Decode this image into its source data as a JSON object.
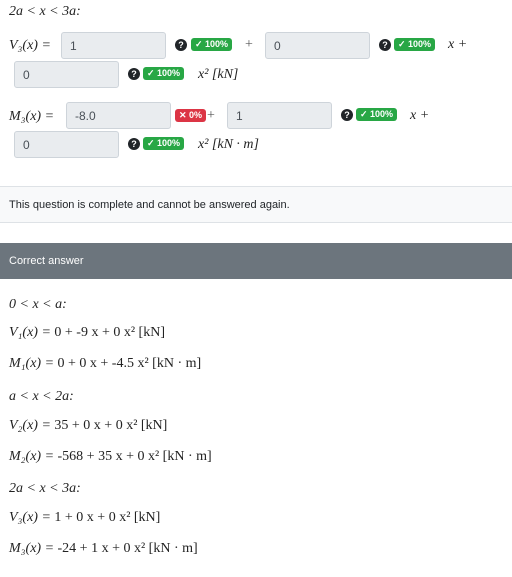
{
  "question": {
    "range_label": "2a < x < 3a:",
    "v3": {
      "label": "V₃(x) =",
      "field1": "1",
      "field2": "0",
      "field3": "0",
      "badge1": "✓ 100%",
      "badge2": "✓ 100%",
      "badge3": "✓ 100%",
      "x_plus": "x +",
      "unit": "x² [kN]"
    },
    "m3": {
      "label": "M₃(x) =",
      "field1": "-8.0",
      "field2": "1",
      "field3": "0",
      "badge1": "✕ 0%",
      "badge2": "✓ 100%",
      "badge3": "✓ 100%",
      "x_plus": "x +",
      "unit": "x² [kN · m]"
    },
    "plus": "+",
    "help_icon": "?"
  },
  "status": {
    "complete_message": "This question is complete and cannot be answered again."
  },
  "correct_answer": {
    "heading": "Correct answer",
    "sections": [
      {
        "range": "0 < x < a:",
        "v_label": "V₁(x) = ",
        "v_value": "0 + -9 x + 0 x² [kN]",
        "m_label": "M₁(x) = ",
        "m_value": "0 + 0 x + -4.5 x² [kN · m]"
      },
      {
        "range": "a < x < 2a:",
        "v_label": "V₂(x) = ",
        "v_value": "35 + 0 x + 0 x² [kN]",
        "m_label": "M₂(x) = ",
        "m_value": "-568 + 35 x + 0 x² [kN · m]"
      },
      {
        "range": "2a < x < 3a:",
        "v_label": "V₃(x) = ",
        "v_value": "1 + 0 x + 0 x² [kN]",
        "m_label": "M₃(x) = ",
        "m_value": "-24 + 1 x + 0 x² [kN · m]"
      }
    ]
  },
  "colors": {
    "correct": "#28a745",
    "incorrect": "#dc3545",
    "header_bg": "#6c757d"
  }
}
